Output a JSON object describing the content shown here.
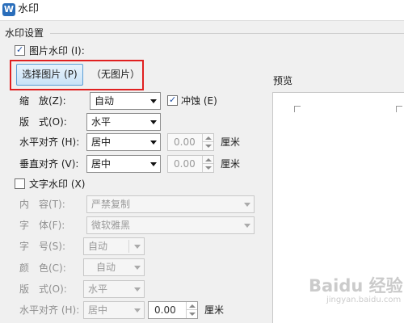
{
  "window": {
    "title": "水印",
    "app_icon_letter": "W"
  },
  "group": {
    "label": "水印设置"
  },
  "picture_watermark": {
    "checkbox_label": "图片水印 (I):",
    "checked": true,
    "select_button": "选择图片 (P)",
    "no_image_label": "（无图片）",
    "scale": {
      "label": "缩　放(Z):",
      "value": "自动"
    },
    "washout": {
      "label": "冲蚀 (E)",
      "checked": true
    },
    "layout": {
      "label": "版　式(O):",
      "value": "水平"
    },
    "h_align": {
      "label": "水平对齐 (H):",
      "value": "居中",
      "offset": "0.00",
      "unit": "厘米"
    },
    "v_align": {
      "label": "垂直对齐 (V):",
      "value": "居中",
      "offset": "0.00",
      "unit": "厘米"
    }
  },
  "text_watermark": {
    "checkbox_label": "文字水印 (X)",
    "checked": false,
    "content": {
      "label": "内　容(T):",
      "value": "严禁复制"
    },
    "font": {
      "label": "字　体(F):",
      "value": "微软雅黑"
    },
    "size": {
      "label": "字　号(S):",
      "value": "自动"
    },
    "color": {
      "label": "颜　色(C):",
      "value": "自动"
    },
    "layout": {
      "label": "版　式(O):",
      "value": "水平"
    },
    "h_align": {
      "label": "水平对齐 (H):",
      "value": "居中",
      "offset": "0.00",
      "unit": "厘米"
    }
  },
  "preview": {
    "label": "预览"
  },
  "watermark_overlay": {
    "text": "Baidu 经验",
    "sub": "jingyan.baidu.com"
  },
  "colors": {
    "highlight": "#e02020",
    "accent": "#2a6ebb",
    "button_face": "#c9e2f7"
  }
}
